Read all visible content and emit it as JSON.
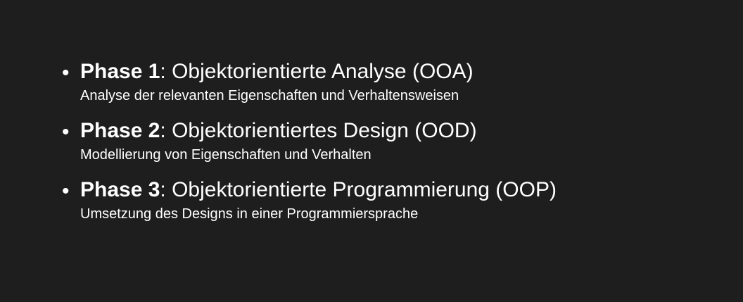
{
  "colors": {
    "background": "#1e1e1e",
    "text": "#ffffff"
  },
  "bullet_icon": "•",
  "phases": [
    {
      "label": "Phase 1",
      "separator": ":",
      "title": " Objektorientierte Analyse (OOA)",
      "description": "Analyse der relevanten Eigenschaften und Verhaltensweisen"
    },
    {
      "label": "Phase 2",
      "separator": ":",
      "title": " Objektorientiertes Design (OOD)",
      "description": "Modellierung von Eigenschaften und Verhalten"
    },
    {
      "label": "Phase 3",
      "separator": ":",
      "title": " Objektorientierte Programmierung (OOP)",
      "description": "Umsetzung des Designs in einer Programmiersprache"
    }
  ]
}
